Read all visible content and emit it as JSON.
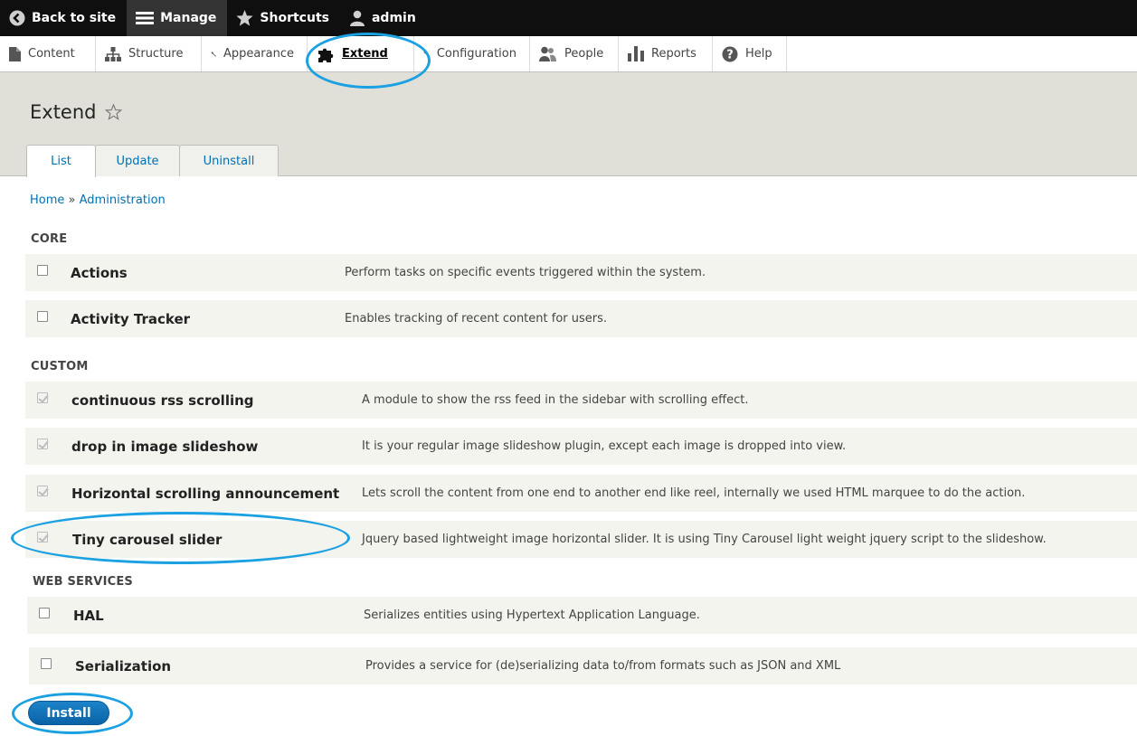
{
  "toolbar": {
    "back_label": "Back to site",
    "manage_label": "Manage",
    "shortcuts_label": "Shortcuts",
    "user_label": "admin"
  },
  "tray": {
    "items": [
      {
        "label": "Content",
        "icon": "file-icon"
      },
      {
        "label": "Structure",
        "icon": "sitemap-icon"
      },
      {
        "label": "Appearance",
        "icon": "brush-icon"
      },
      {
        "label": "Extend",
        "icon": "puzzle-icon"
      },
      {
        "label": "Configuration",
        "icon": "wrench-icon"
      },
      {
        "label": "People",
        "icon": "people-icon"
      },
      {
        "label": "Reports",
        "icon": "bar-chart-icon"
      },
      {
        "label": "Help",
        "icon": "help-icon"
      }
    ]
  },
  "page": {
    "title": "Extend",
    "tabs": [
      "List",
      "Update",
      "Uninstall"
    ]
  },
  "breadcrumb": {
    "home": "Home",
    "separator": "»",
    "admin": "Administration"
  },
  "sections": {
    "core": "CORE",
    "custom": "CUSTOM",
    "web_services": "WEB SERVICES"
  },
  "modules": {
    "core": [
      {
        "name": "Actions",
        "description": "Perform tasks on specific events triggered within the system.",
        "checked": false
      },
      {
        "name": "Activity Tracker",
        "description": "Enables tracking of recent content for users.",
        "checked": false
      }
    ],
    "custom": [
      {
        "name": "continuous rss scrolling",
        "description": "A module to show the rss feed in the sidebar with scrolling effect.",
        "checked": true
      },
      {
        "name": "drop in image slideshow",
        "description": "It is your regular image slideshow plugin, except each image is dropped into view.",
        "checked": true
      },
      {
        "name": "Horizontal scrolling announcement",
        "description": "Lets scroll the content from one end to another end like reel, internally we used HTML marquee to do the action.",
        "checked": true
      },
      {
        "name": "Tiny carousel slider",
        "description": "Jquery based lightweight image horizontal slider. It is using Tiny Carousel light weight jquery script to the slideshow.",
        "checked": true
      }
    ],
    "web_services": [
      {
        "name": "HAL",
        "description": "Serializes entities using Hypertext Application Language.",
        "checked": false
      },
      {
        "name": "Serialization",
        "description": "Provides a service for (de)serializing data to/from formats such as JSON and XML",
        "checked": false
      }
    ]
  },
  "actions": {
    "install_label": "Install"
  },
  "colors": {
    "link": "#0071b3",
    "annotation": "#1ba1e2",
    "toolbar_bg": "#0f0f0f"
  }
}
